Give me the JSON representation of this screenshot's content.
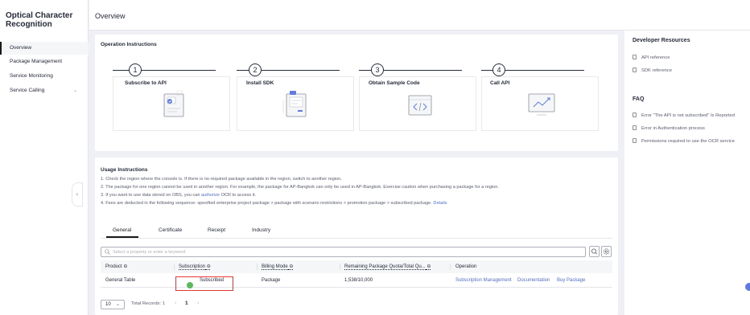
{
  "sidebar": {
    "title": "Optical Character Recognition",
    "items": [
      {
        "label": "Overview",
        "active": true
      },
      {
        "label": "Package Management"
      },
      {
        "label": "Service Monitoring"
      },
      {
        "label": "Service Calling",
        "has_chevron": true
      }
    ]
  },
  "header": {
    "title": "Overview"
  },
  "operations": {
    "title": "Operation Instructions",
    "steps": [
      {
        "number": "1",
        "label": "Subscribe to API"
      },
      {
        "number": "2",
        "label": "Install SDK"
      },
      {
        "number": "3",
        "label": "Obtain Sample Code"
      },
      {
        "number": "4",
        "label": "Call API"
      }
    ]
  },
  "usage": {
    "title": "Usage Instructions",
    "line1": "1. Check the region where the console is. If there is no required package available in the region, switch to another region.",
    "line2": "2. The package for one region cannot be used in another region. For example, the package for AP-Bangkok can only be used in AP-Bangkok. Exercise caution when purchasing a package for a region.",
    "line3_pre": "3. If you want to use data stored on OBS, you can ",
    "line3_link": "authorize",
    "line3_post": " OCR to access it.",
    "line4_pre": "4. Fees are deducted in the following sequence: specified enterprise project package > package with scenario restrictions > promotion package > subscribed package. ",
    "line4_link": "Details"
  },
  "tabs": [
    {
      "label": "General",
      "active": true
    },
    {
      "label": "Certificate"
    },
    {
      "label": "Receipt"
    },
    {
      "label": "Industry"
    }
  ],
  "search": {
    "placeholder": "Select a property or enter a keyword."
  },
  "table": {
    "columns": [
      "Product",
      "Subscription",
      "Billing Mode",
      "Remaining Package Quota/Total Qu...",
      "Operation"
    ],
    "rows": [
      {
        "product": "General Table",
        "subscription": "Subscribed",
        "billing_mode": "Package",
        "quota": "1,538/10,000",
        "actions": [
          "Subscription Management",
          "Documentation",
          "Buy Package"
        ]
      }
    ]
  },
  "pagination": {
    "page_size": "10",
    "total": "Total Records: 1",
    "current_page": "1"
  },
  "developer_resources": {
    "title": "Developer Resources",
    "items": [
      "API reference",
      "SDK reference"
    ]
  },
  "faq": {
    "title": "FAQ",
    "items": [
      "Error \"The API is not subscribed\" Is Reported",
      "Error in Authentication process",
      "Permissions required to use the OCR service"
    ]
  },
  "colors": {
    "link": "#526ecc",
    "subscribed": "#5cb85c",
    "highlight_border": "#e53935"
  }
}
